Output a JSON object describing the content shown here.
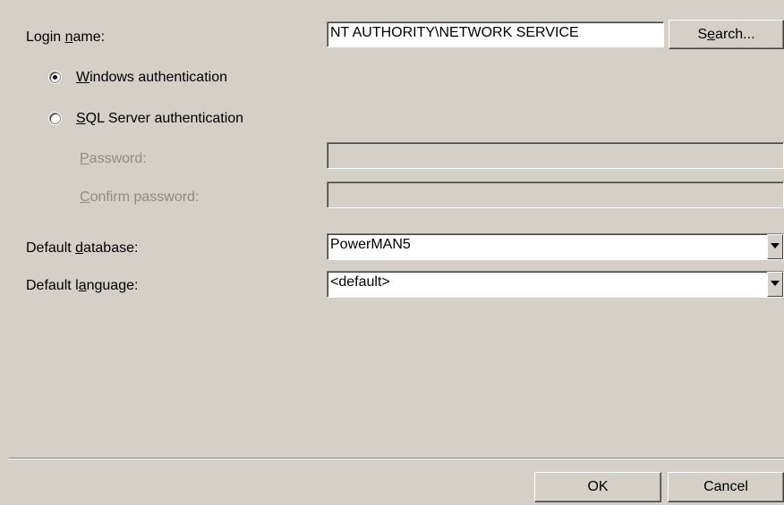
{
  "login": {
    "label_pre": "Login ",
    "label_ul": "n",
    "label_post": "ame:",
    "value": "NT AUTHORITY\\NETWORK SERVICE",
    "search_pre": "S",
    "search_ul": "e",
    "search_post": "arch..."
  },
  "auth": {
    "windows": {
      "ul": "W",
      "rest": "indows authentication",
      "selected": true
    },
    "sql": {
      "ul": "S",
      "rest": "QL Server authentication",
      "selected": false
    }
  },
  "password": {
    "ul": "P",
    "rest": "assword:",
    "value": ""
  },
  "confirm_password": {
    "ul": "C",
    "rest": "onfirm password:",
    "value": ""
  },
  "default_database": {
    "label_pre": "Default ",
    "label_ul": "d",
    "label_post": "atabase:",
    "value": "PowerMAN5"
  },
  "default_language": {
    "label_pre": "Default l",
    "label_ul": "a",
    "label_post": "nguage:",
    "value": "<default>"
  },
  "buttons": {
    "ok": "OK",
    "cancel": "Cancel"
  }
}
